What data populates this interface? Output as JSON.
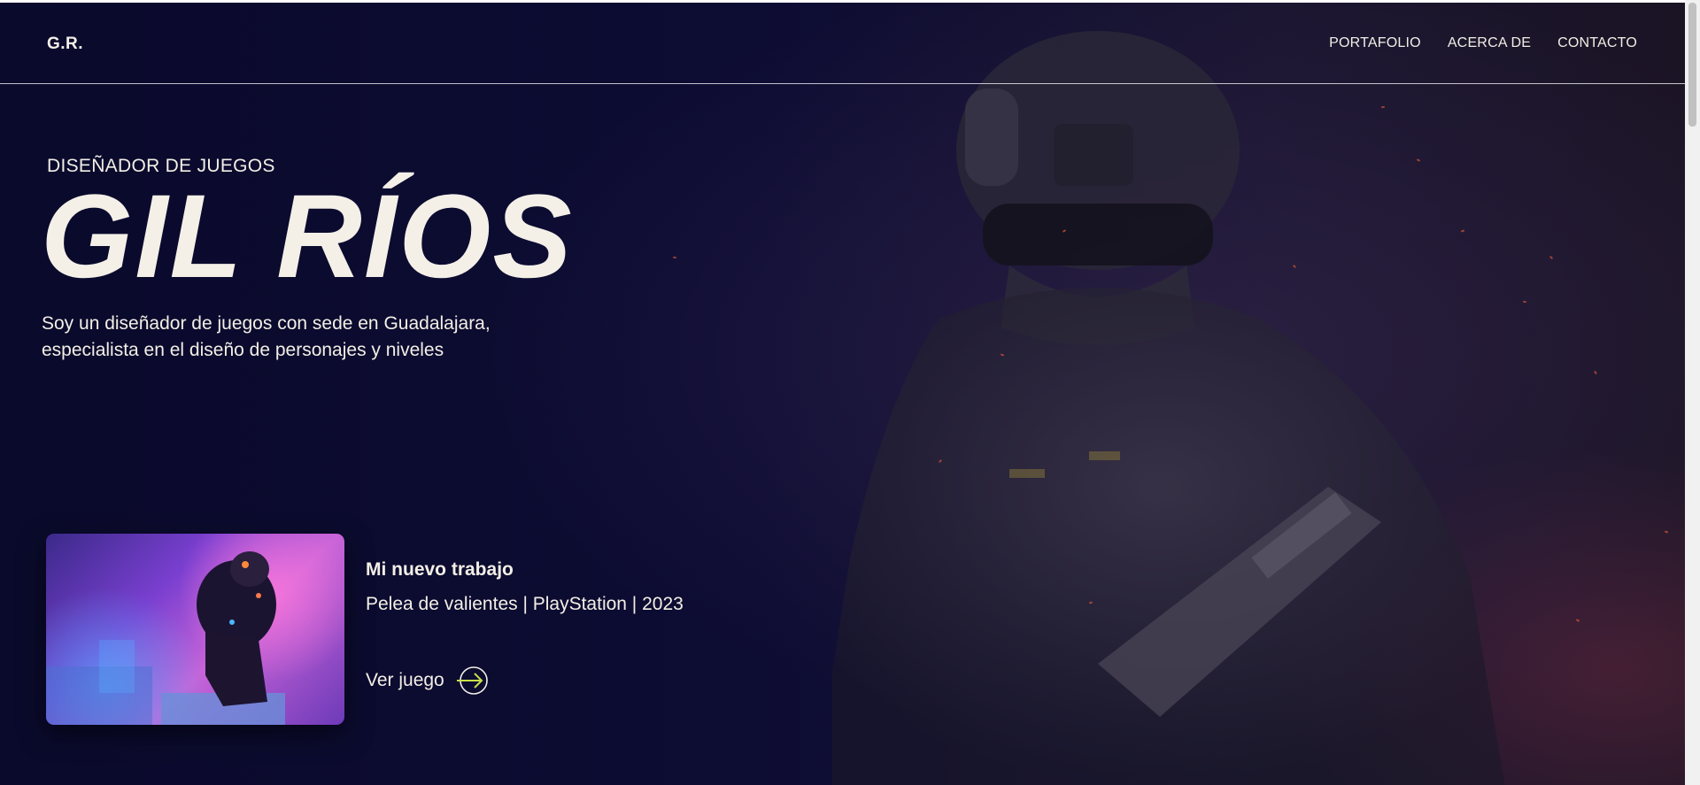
{
  "header": {
    "logo": "G.R.",
    "nav": [
      {
        "label": "PORTAFOLIO"
      },
      {
        "label": "ACERCA DE"
      },
      {
        "label": "CONTACTO"
      }
    ]
  },
  "hero": {
    "subtitle": "DISEÑADOR DE JUEGOS",
    "name": "GIL RÍOS",
    "bio_line1": "Soy un diseñador de juegos con sede en Guadalajara,",
    "bio_line2": "especialista en el diseño de personajes y niveles"
  },
  "featured": {
    "title": "Mi nuevo trabajo",
    "meta": "Pelea de valientes | PlayStation | 2023",
    "link_label": "Ver juego",
    "link_icon": "arrow-right-circle-icon",
    "accent_color": "#c8e04a"
  },
  "colors": {
    "background": "#0b0b2a",
    "text": "#f3efe6"
  }
}
